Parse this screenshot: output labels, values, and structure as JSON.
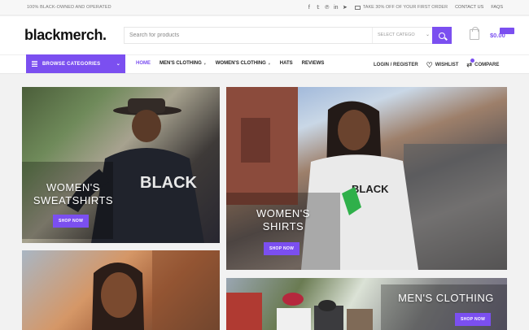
{
  "topbar": {
    "tagline": "100% BLACK-OWNED AND OPERATED",
    "promo": "TAKE 30% OFF OF YOUR FIRST ORDER",
    "contact": "CONTACT US",
    "faqs": "FAQS",
    "social_icons": [
      "facebook-icon",
      "twitter-icon",
      "pinterest-icon",
      "linkedin-icon",
      "telegram-icon"
    ]
  },
  "header": {
    "logo": "blackmerch.",
    "search_placeholder": "Search for products",
    "category_select": "SELECT CATEGO",
    "cart_total": "$0.00"
  },
  "nav": {
    "browse": "BROWSE CATEGORIES",
    "menu": [
      {
        "label": "HOME",
        "active": true,
        "dropdown": false
      },
      {
        "label": "MEN'S CLOTHING",
        "active": false,
        "dropdown": true
      },
      {
        "label": "WOMEN'S CLOTHING",
        "active": false,
        "dropdown": true
      },
      {
        "label": "HATS",
        "active": false,
        "dropdown": false
      },
      {
        "label": "REVIEWS",
        "active": false,
        "dropdown": false
      }
    ],
    "login": "LOGIN / REGISTER",
    "wishlist": "WISHLIST",
    "compare": "COMPARE"
  },
  "tiles": [
    {
      "title": "WOMEN'S SWEATSHIRTS",
      "cta": "SHOP NOW"
    },
    {
      "title": "WOMEN'S SHIRTS",
      "cta": "SHOP NOW"
    },
    {
      "title": "",
      "cta": ""
    },
    {
      "title": "MEN'S CLOTHING",
      "cta": "SHOP NOW"
    }
  ],
  "colors": {
    "accent": "#7b4ff0"
  }
}
